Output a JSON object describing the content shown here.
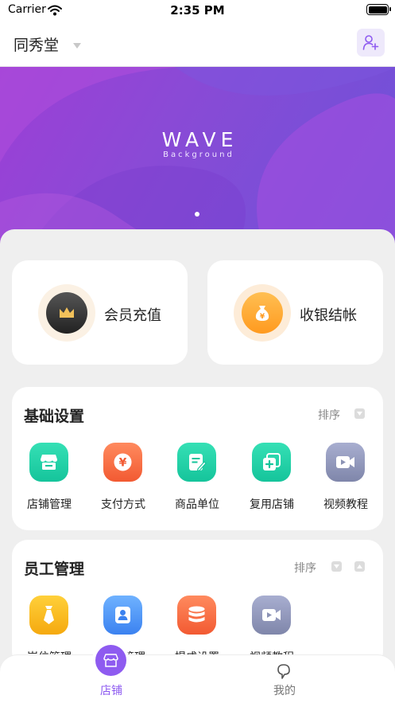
{
  "status_bar": {
    "carrier": "Carrier",
    "time": "2:35 PM"
  },
  "nav": {
    "title": "同秀堂"
  },
  "banner": {
    "title": "WAVE",
    "subtitle": "Background",
    "slide_index": 1,
    "slide_count": 1
  },
  "quick_actions": [
    {
      "label": "会员充值",
      "icon": "crown-icon"
    },
    {
      "label": "收银结帐",
      "icon": "money-bag-icon"
    }
  ],
  "basic_settings": {
    "title": "基础设置",
    "sort_label": "排序",
    "items": [
      {
        "label": "店铺管理",
        "icon": "storefront-icon"
      },
      {
        "label": "支付方式",
        "icon": "yen-icon"
      },
      {
        "label": "商品单位",
        "icon": "edit-document-icon"
      },
      {
        "label": "复用店铺",
        "icon": "copy-add-icon"
      },
      {
        "label": "视频教程",
        "icon": "video-icon"
      }
    ]
  },
  "staff_management": {
    "title": "员工管理",
    "sort_label": "排序",
    "items": [
      {
        "label": "岗位管理",
        "icon": "tie-icon"
      },
      {
        "label": "员工管理",
        "icon": "person-icon"
      },
      {
        "label": "提成设置",
        "icon": "coin-stack-icon"
      },
      {
        "label": "视频教程",
        "icon": "video-icon"
      }
    ]
  },
  "tab_bar": {
    "tabs": [
      {
        "label": "店铺",
        "icon": "store-icon",
        "active": true
      },
      {
        "label": "我的",
        "icon": "profile-icon",
        "active": false
      }
    ]
  },
  "colors": {
    "accent": "#8e5bf0",
    "banner_start": "#9c3fd6",
    "banner_end": "#6c52d8",
    "teal": "#1fcfa8",
    "orange": "#fb6d45",
    "gold": "#f5b51a",
    "blue": "#4a8ff5",
    "slate": "#8c93b5"
  }
}
